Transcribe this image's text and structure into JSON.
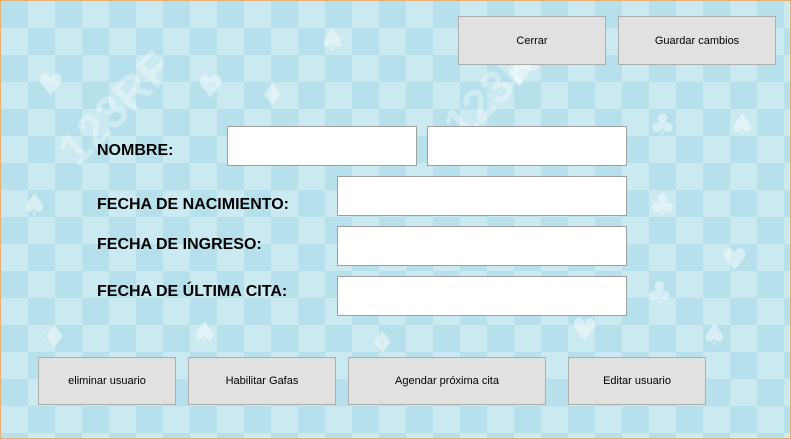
{
  "toolbar": {
    "close_label": "Cerrar",
    "save_label": "Guardar cambios"
  },
  "form": {
    "name_label": "NOMBRE:",
    "first_name_value": "",
    "last_name_value": "",
    "birth_date_label": "FECHA DE NACIMIENTO:",
    "birth_date_value": "",
    "admission_date_label": "FECHA DE INGRESO:",
    "admission_date_value": "",
    "last_appointment_label": "FECHA DE ÚLTIMA CITA:",
    "last_appointment_value": ""
  },
  "actions": {
    "delete_user_label": "eliminar usuario",
    "enable_glasses_label": "Habilitar Gafas",
    "schedule_next_label": "Agendar próxima cita",
    "edit_user_label": "Editar usuario"
  },
  "colors": {
    "background": "#b6e0ec",
    "button": "#e1e1e1",
    "window_border": "#e8b070"
  },
  "icons": [
    "heart-icon",
    "spade-icon",
    "club-icon",
    "diamond-icon"
  ]
}
